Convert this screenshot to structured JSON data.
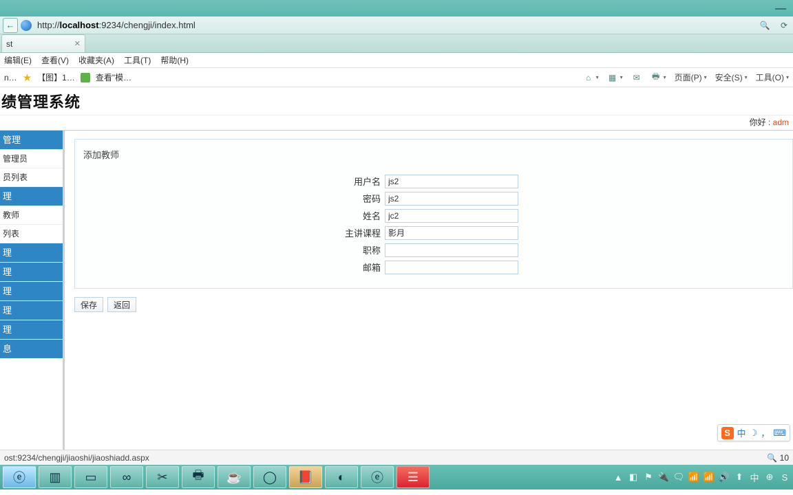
{
  "window": {
    "minimize": "—"
  },
  "address": {
    "back": "←",
    "url_prefix": "http://",
    "url_host": "localhost",
    "url_rest": ":9234/chengji/index.html",
    "search_icon": "🔍",
    "refresh_icon": "⟳"
  },
  "tab": {
    "title": "st",
    "close": "✕"
  },
  "iemenu": {
    "edit": "编辑(E)",
    "view": "查看(V)",
    "favorites": "收藏夹(A)",
    "tools": "工具(T)",
    "help": "帮助(H)"
  },
  "ietoolbar_left": {
    "item1": "n…",
    "item2": "【图】1…",
    "item3": "查看\"模…"
  },
  "ietoolbar_right": {
    "home": "⌂",
    "feeds": "▦",
    "mail": "✉",
    "print": "🖶",
    "page": "页面(P)",
    "safety": "安全(S)",
    "tools": "工具(O)",
    "caret": "▾"
  },
  "header": {
    "title": "绩管理系统"
  },
  "greeting": {
    "hello": "你好 :",
    "username": "adm"
  },
  "sidebar": {
    "sec1": "管理",
    "items1": [
      "管理员",
      "员列表"
    ],
    "sec2": "理",
    "items2": [
      "教师",
      "列表"
    ],
    "sec3": "理",
    "sec4": "理",
    "sec5": "理",
    "sec6": "理",
    "sec7": "理",
    "sec8": "息"
  },
  "panel": {
    "title": "添加教师"
  },
  "form": {
    "labels": {
      "username": "用户名",
      "password": "密码",
      "name": "姓名",
      "course": "主讲课程",
      "title": "职称",
      "email": "邮箱"
    },
    "values": {
      "username": "js2",
      "password": "js2",
      "name": "jc2",
      "course": "影月",
      "title": "",
      "email": ""
    }
  },
  "actions": {
    "save": "保存",
    "back": "返回"
  },
  "ime": {
    "logo": "S",
    "lang": "中",
    "moon": "☽",
    "comma": "，",
    "kb": "⌨"
  },
  "status": {
    "text": "ost:9234/chengji/jiaoshi/jiaoshiadd.aspx",
    "zoom": "10"
  },
  "taskbar": {
    "apps": [
      "ⓔ",
      "▥",
      "▭",
      "∞",
      "✂",
      "🖶",
      "☕",
      "◯",
      "📕",
      "◐",
      "ⓔ",
      "☰"
    ],
    "tray": [
      "▲",
      "◧",
      "⚑",
      "🔌",
      "🗨",
      "📶",
      "📶",
      "🔊",
      "⬆",
      "中",
      "⊕",
      "S"
    ]
  }
}
